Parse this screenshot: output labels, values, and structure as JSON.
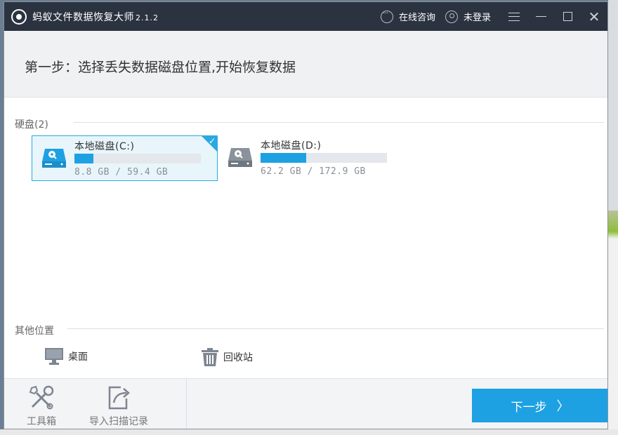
{
  "app": {
    "title": "蚂蚁文件数据恢复大师",
    "version": "2.1.2"
  },
  "titlebar": {
    "online_consult": "在线咨询",
    "login": "未登录"
  },
  "step": {
    "title": "第一步：选择丢失数据磁盘位置,开始恢复数据"
  },
  "hard_disks": {
    "label": "硬盘(2)",
    "items": [
      {
        "name": "本地磁盘(C:)",
        "size": "8.8 GB / 59.4 GB",
        "used_fraction": 0.148,
        "selected": true
      },
      {
        "name": "本地磁盘(D:)",
        "size": "62.2 GB / 172.9 GB",
        "used_fraction": 0.36,
        "selected": false
      }
    ]
  },
  "other_locations": {
    "label": "其他位置",
    "items": [
      {
        "name": "桌面",
        "icon": "desktop-monitor-icon"
      },
      {
        "name": "回收站",
        "icon": "recycle-bin-icon"
      }
    ]
  },
  "bottom": {
    "toolbox": "工具箱",
    "import_scan": "导入扫描记录",
    "next": "下一步"
  },
  "colors": {
    "accent": "#1ea1e3",
    "titlebar": "#2b3240",
    "header_bg": "#f0f1f2"
  }
}
